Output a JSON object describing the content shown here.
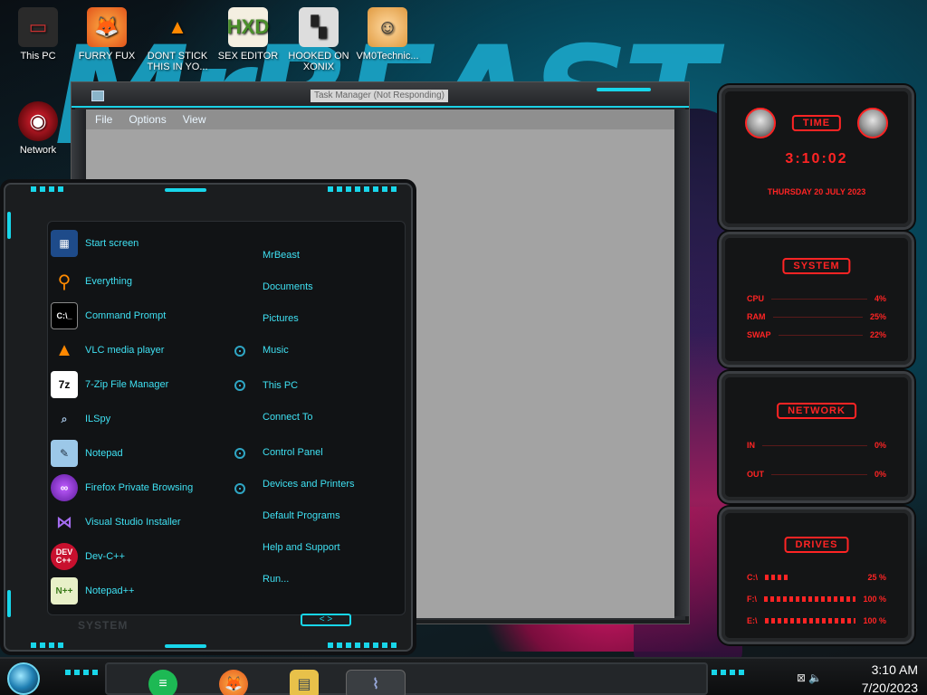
{
  "wallpaper": {
    "text": "MrBEAST"
  },
  "desktop_icons": [
    {
      "label": "This PC"
    },
    {
      "label": "FURRY FUX"
    },
    {
      "label": "DONT STICK THIS IN YO..."
    },
    {
      "label": "SEX EDITOR"
    },
    {
      "label": "HOOKED ON XONIX"
    },
    {
      "label": "VM0Technic..."
    },
    {
      "label": "Network"
    }
  ],
  "task_manager": {
    "title": "Task Manager (Not Responding)",
    "menu": [
      "File",
      "Options",
      "View"
    ]
  },
  "start_menu": {
    "programs": [
      "Start screen",
      "Everything",
      "Command Prompt",
      "VLC media player",
      "7-Zip File Manager",
      "ILSpy",
      "Notepad",
      "Firefox Private Browsing",
      "Visual Studio Installer",
      "Dev-C++",
      "Notepad++"
    ],
    "places": [
      "MrBeast",
      "Documents",
      "Pictures",
      "Music",
      "This PC",
      "Connect To",
      "Control Panel",
      "Devices and Printers",
      "Default Programs",
      "Help and Support",
      "Run..."
    ],
    "footer_label": "SYSTEM",
    "nav_label": "< >"
  },
  "gadgets": {
    "time": {
      "title": "TIME",
      "clock": "3:10:02",
      "date": "THURSDAY 20 JULY 2023"
    },
    "system": {
      "title": "SYSTEM",
      "rows": [
        {
          "label": "CPU",
          "value": "4%"
        },
        {
          "label": "RAM",
          "value": "25%"
        },
        {
          "label": "SWAP",
          "value": "22%"
        }
      ]
    },
    "network": {
      "title": "NETWORK",
      "rows": [
        {
          "label": "IN",
          "value": "0%"
        },
        {
          "label": "OUT",
          "value": "0%"
        }
      ]
    },
    "drives": {
      "title": "DRIVES",
      "rows": [
        {
          "label": "C:\\",
          "value": "25 %"
        },
        {
          "label": "F:\\",
          "value": "100 %"
        },
        {
          "label": "E:\\",
          "value": "100 %"
        }
      ]
    }
  },
  "taskbar": {
    "time": "3:10 AM",
    "date": "7/20/2023"
  },
  "colors": {
    "accent": "#18d6ea",
    "gadget_red": "#ff2424"
  }
}
